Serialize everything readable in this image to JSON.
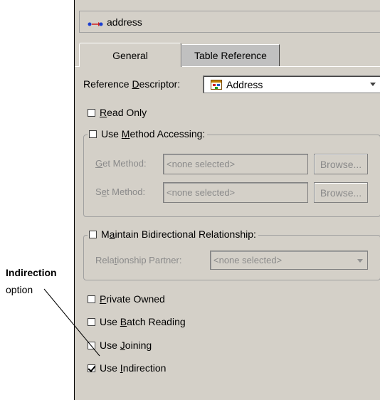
{
  "callout": {
    "title": "Indirection",
    "subtitle": "option"
  },
  "mapping": {
    "name": "address"
  },
  "tabs": [
    {
      "label": "General",
      "active": true
    },
    {
      "label": "Table Reference",
      "active": false
    }
  ],
  "reference_descriptor": {
    "label_pre": "Reference ",
    "label_mnemonic": "D",
    "label_post": "escriptor:",
    "value": "Address"
  },
  "read_only": {
    "pre": "",
    "mn": "R",
    "post": "ead Only",
    "checked": false
  },
  "method_accessing": {
    "pre": "Use ",
    "mn": "M",
    "post": "ethod Accessing:",
    "checked": false,
    "get_label_mn": "G",
    "get_label_post": "et Method:",
    "get_value": "<none selected>",
    "set_label_pre": "S",
    "set_label_mn": "e",
    "set_label_post": "t Method:",
    "set_value": "<none selected>",
    "browse_label": "Browse..."
  },
  "bidirectional": {
    "pre": "M",
    "mn": "a",
    "post": "intain Bidirectional Relationship:",
    "checked": false,
    "partner_pre": "Rela",
    "partner_mn": "t",
    "partner_post": "ionship Partner:",
    "partner_value": "<none selected>"
  },
  "options": [
    {
      "pre": "",
      "mn": "P",
      "post": "rivate Owned",
      "checked": false
    },
    {
      "pre": "Use ",
      "mn": "B",
      "post": "atch Reading",
      "checked": false
    },
    {
      "pre": "Use ",
      "mn": "J",
      "post": "oining",
      "checked": false
    },
    {
      "pre": "Use ",
      "mn": "I",
      "post": "ndirection",
      "checked": true
    }
  ]
}
